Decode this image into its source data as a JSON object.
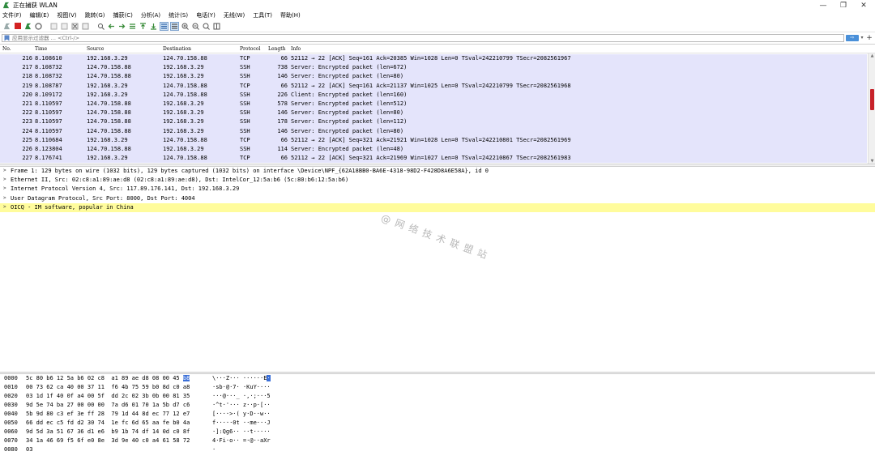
{
  "window": {
    "title": "正在捕获 WLAN",
    "controls": {
      "minimize": "—",
      "restore": "❐",
      "close": "✕"
    }
  },
  "menu": [
    "文件(F)",
    "编辑(E)",
    "视图(V)",
    "跳转(G)",
    "捕获(C)",
    "分析(A)",
    "统计(S)",
    "电话(Y)",
    "无线(W)",
    "工具(T)",
    "帮助(H)"
  ],
  "filter": {
    "placeholder": "应用显示过滤器 … <Ctrl-/>",
    "apply_label": "⇨",
    "dropdown": "▾",
    "add": "+"
  },
  "packet_list": {
    "columns": [
      "No.",
      "Time",
      "Source",
      "Destination",
      "Protocol",
      "Length",
      "Info"
    ],
    "rows": [
      {
        "no": "216",
        "time": "8.108610",
        "src": "192.168.3.29",
        "dst": "124.70.158.88",
        "proto": "TCP",
        "len": "66",
        "info": "52112 → 22 [ACK] Seq=161 Ack=20385 Win=1028 Len=0 TSval=242210799 TSecr=2082561967"
      },
      {
        "no": "217",
        "time": "8.108732",
        "src": "124.70.158.88",
        "dst": "192.168.3.29",
        "proto": "SSH",
        "len": "738",
        "info": "Server: Encrypted packet (len=672)"
      },
      {
        "no": "218",
        "time": "8.108732",
        "src": "124.70.158.88",
        "dst": "192.168.3.29",
        "proto": "SSH",
        "len": "146",
        "info": "Server: Encrypted packet (len=80)"
      },
      {
        "no": "219",
        "time": "8.108787",
        "src": "192.168.3.29",
        "dst": "124.70.158.88",
        "proto": "TCP",
        "len": "66",
        "info": "52112 → 22 [ACK] Seq=161 Ack=21137 Win=1025 Len=0 TSval=242210799 TSecr=2082561968"
      },
      {
        "no": "220",
        "time": "8.109172",
        "src": "192.168.3.29",
        "dst": "124.70.158.88",
        "proto": "SSH",
        "len": "226",
        "info": "Client: Encrypted packet (len=160)"
      },
      {
        "no": "221",
        "time": "8.110597",
        "src": "124.70.158.88",
        "dst": "192.168.3.29",
        "proto": "SSH",
        "len": "578",
        "info": "Server: Encrypted packet (len=512)"
      },
      {
        "no": "222",
        "time": "8.110597",
        "src": "124.70.158.88",
        "dst": "192.168.3.29",
        "proto": "SSH",
        "len": "146",
        "info": "Server: Encrypted packet (len=80)"
      },
      {
        "no": "223",
        "time": "8.110597",
        "src": "124.70.158.88",
        "dst": "192.168.3.29",
        "proto": "SSH",
        "len": "178",
        "info": "Server: Encrypted packet (len=112)"
      },
      {
        "no": "224",
        "time": "8.110597",
        "src": "124.70.158.88",
        "dst": "192.168.3.29",
        "proto": "SSH",
        "len": "146",
        "info": "Server: Encrypted packet (len=80)"
      },
      {
        "no": "225",
        "time": "8.110684",
        "src": "192.168.3.29",
        "dst": "124.70.158.88",
        "proto": "TCP",
        "len": "66",
        "info": "52112 → 22 [ACK] Seq=321 Ack=21921 Win=1028 Len=0 TSval=242210801 TSecr=2082561969"
      },
      {
        "no": "226",
        "time": "8.123804",
        "src": "124.70.158.88",
        "dst": "192.168.3.29",
        "proto": "SSH",
        "len": "114",
        "info": "Server: Encrypted packet (len=48)"
      },
      {
        "no": "227",
        "time": "8.176741",
        "src": "192.168.3.29",
        "dst": "124.70.158.88",
        "proto": "TCP",
        "len": "66",
        "info": "52112 → 22 [ACK] Seq=321 Ack=21969 Win=1027 Len=0 TSval=242210867 TSecr=2082561983"
      }
    ]
  },
  "details": {
    "rows": [
      {
        "arrow": ">",
        "text": "Frame 1: 129 bytes on wire (1032 bits), 129 bytes captured (1032 bits) on interface \\Device\\NPF_{62A18BB0-BA6E-4318-98D2-F428D8A6E58A}, id 0"
      },
      {
        "arrow": ">",
        "text": "Ethernet II, Src: 02:c8:a1:89:ae:d8 (02:c8:a1:89:ae:d8), Dst: IntelCor_12:5a:b6 (5c:80:b6:12:5a:b6)"
      },
      {
        "arrow": ">",
        "text": "Internet Protocol Version 4, Src: 117.89.176.141, Dst: 192.168.3.29"
      },
      {
        "arrow": ">",
        "text": "User Datagram Protocol, Src Port: 8000, Dst Port: 4004"
      },
      {
        "arrow": ">",
        "text": "OICQ - IM software, popular in China"
      }
    ]
  },
  "watermark": "@网络技术联盟站",
  "bytes": {
    "rows": [
      {
        "off": "0000",
        "hex": "5c 80 b6 12 5a b6 02 c8  a1 89 ae d8 08 00 45 ",
        "hexhl": "b8",
        "ascii": "\\···Z··· ······E",
        "asciihl": "·"
      },
      {
        "off": "0010",
        "hex": "00 73 62 ca 40 00 37 11  f6 4b 75 59 b0 8d c0 a8",
        "hexhl": "",
        "ascii": "·sb·@·7· ·KuY····",
        "asciihl": ""
      },
      {
        "off": "0020",
        "hex": "03 1d 1f 40 0f a4 00 5f  dd 2c 02 3b 0b 00 81 35",
        "hexhl": "",
        "ascii": "···@···_ ·,·;···5",
        "asciihl": ""
      },
      {
        "off": "0030",
        "hex": "9d 5e 74 ba 27 00 00 00  7a d6 01 70 1a 5b d7 c6",
        "hexhl": "",
        "ascii": "·^t·'··· z··p·[··",
        "asciihl": ""
      },
      {
        "off": "0040",
        "hex": "5b 9d 80 c3 ef 3e ff 28  79 1d 44 8d ec 77 12 e7",
        "hexhl": "",
        "ascii": "[····>·( y·D··w··",
        "asciihl": ""
      },
      {
        "off": "0050",
        "hex": "66 dd ec c5 fd d2 30 74  1e fc 6d 65 aa fe b0 4a",
        "hexhl": "",
        "ascii": "f·····0t ··me···J",
        "asciihl": ""
      },
      {
        "off": "0060",
        "hex": "9d 5d 3a 51 67 36 d1 e6  b9 1b 74 df 14 0d c0 8f",
        "hexhl": "",
        "ascii": "·]:Qg6·· ··t·····",
        "asciihl": ""
      },
      {
        "off": "0070",
        "hex": "34 1a 46 69 f5 6f e0 8e  3d 9e 40 c0 a4 61 58 72",
        "hexhl": "",
        "ascii": "4·Fi·o·· =·@··aXr",
        "asciihl": ""
      },
      {
        "off": "0080",
        "hex": "03",
        "hexhl": "",
        "ascii": "·",
        "asciihl": ""
      }
    ]
  },
  "colors": {
    "row_bg": "#e4e4fb",
    "selected_detail": "#fffc9c",
    "byte_highlight": "#3a6fd8",
    "scroll_thumb": "#c7222a"
  }
}
